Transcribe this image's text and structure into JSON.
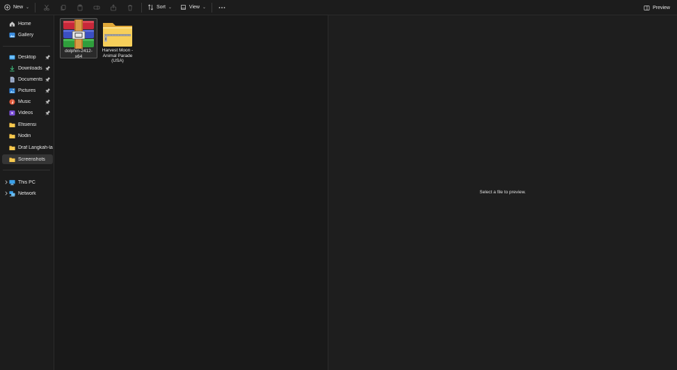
{
  "toolbar": {
    "new_label": "New",
    "sort_label": "Sort",
    "view_label": "View",
    "preview_label": "Preview",
    "actions": [
      "cut-icon",
      "copy-icon",
      "paste-icon",
      "rename-icon",
      "share-icon",
      "delete-icon"
    ]
  },
  "sidebar": {
    "top": [
      {
        "label": "Home",
        "icon": "home-icon"
      },
      {
        "label": "Gallery",
        "icon": "gallery-icon"
      }
    ],
    "quick": [
      {
        "label": "Desktop",
        "icon": "desktop-icon",
        "pinned": true
      },
      {
        "label": "Downloads",
        "icon": "download-icon",
        "pinned": true
      },
      {
        "label": "Documents",
        "icon": "documents-icon",
        "pinned": true
      },
      {
        "label": "Pictures",
        "icon": "pictures-icon",
        "pinned": true
      },
      {
        "label": "Music",
        "icon": "music-icon",
        "pinned": true
      },
      {
        "label": "Videos",
        "icon": "videos-icon",
        "pinned": true
      },
      {
        "label": "Efisiensi",
        "icon": "folder-icon",
        "pinned": false
      },
      {
        "label": "Nodin",
        "icon": "folder-icon",
        "pinned": false
      },
      {
        "label": "Draf Langkah-langkah",
        "icon": "folder-icon",
        "pinned": false
      },
      {
        "label": "Screenshots",
        "icon": "folder-icon",
        "pinned": false,
        "active": true
      }
    ],
    "devices": [
      {
        "label": "This PC",
        "icon": "this-pc-icon"
      },
      {
        "label": "Network",
        "icon": "network-icon"
      }
    ]
  },
  "files": [
    {
      "name": "dolphin-2412-x64",
      "type": "archive",
      "selected": true
    },
    {
      "name": "Harvest Moon - Animal Parade (USA)",
      "type": "zip-folder",
      "selected": false
    }
  ],
  "preview": {
    "message": "Select a file to preview."
  },
  "colors": {
    "background": "#191919",
    "sidebar": "#1c1c1c",
    "folder": "#f2c14e",
    "active": "#353535"
  }
}
